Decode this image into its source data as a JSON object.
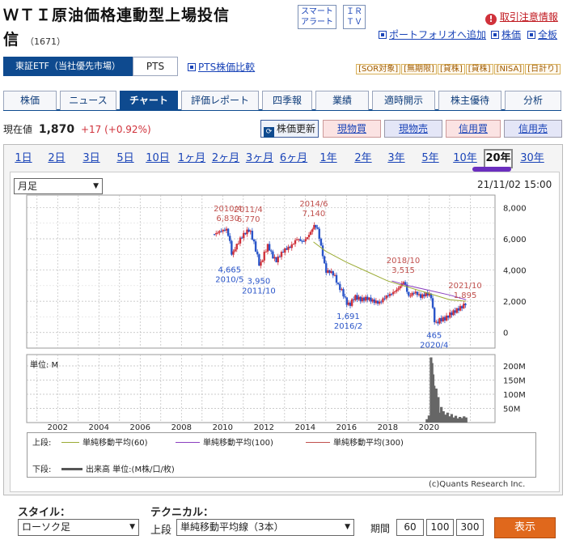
{
  "header": {
    "title": "ＷＴＩ原油価格連動型上場投信",
    "code": "（1671）",
    "smart_alert": [
      "スマート",
      "アラート"
    ],
    "ir_tv": [
      "ＩＲ",
      "ＴＶ"
    ],
    "caution": "取引注意情報",
    "portfolio_add": "ポートフォリオへ追加",
    "stock_price": "株価",
    "full_board": "全板"
  },
  "market": {
    "tab_active": "東証ETF（当社優先市場）",
    "tab_pts": "PTS",
    "pts_compare": "PTS株価比較",
    "badges": [
      "[SOR対象]",
      "[無期限]",
      "[貸株]",
      "[貸株]",
      "[NISA]",
      "[日計り]"
    ]
  },
  "nav": [
    "株価",
    "ニュース",
    "チャート",
    "評価レポート",
    "四季報",
    "業績",
    "適時開示",
    "株主優待",
    "分析"
  ],
  "quote": {
    "label": "現在値",
    "price": "1,870",
    "change": "+17 (+0.92%)",
    "refresh": "株価更新",
    "buttons": [
      "現物買",
      "現物売",
      "信用買",
      "信用売"
    ]
  },
  "periods": [
    "1日",
    "2日",
    "3日",
    "5日",
    "10日",
    "1ヶ月",
    "2ヶ月",
    "3ヶ月",
    "6ヶ月",
    "1年",
    "2年",
    "3年",
    "5年",
    "10年",
    "20年",
    "30年"
  ],
  "chart_controls": {
    "interval": "月足",
    "timestamp": "21/11/02 15:00",
    "unit": "単位: M",
    "credit": "(c)Quants Research Inc."
  },
  "legend": {
    "upper_label": "上段:",
    "lower_label": "下段:",
    "items": [
      "単純移動平均(60)",
      "単純移動平均(100)",
      "単純移動平均(300)"
    ],
    "volume": "出来高 単位:(M株/口/枚)"
  },
  "bottom": {
    "style_label": "スタイル：",
    "style_value": "ローソク足",
    "tech_label": "テクニカル：",
    "upper": "上段",
    "tech_value": "単純移動平均線（3本）",
    "period_label": "期間",
    "periods": [
      "60",
      "100",
      "300"
    ],
    "show": "表示"
  },
  "colors": {
    "navy": "#0e4a8f",
    "rise": "#d0323b",
    "fall": "#2a55c9",
    "ma60": "#9bab35",
    "ma100": "#8a3fbf",
    "ma300": "#c0504d"
  },
  "chart_data": {
    "type": "candlestick",
    "x_ticks": [
      "2002",
      "2004",
      "2006",
      "2008",
      "2010",
      "2012",
      "2014",
      "2016",
      "2018",
      "2020"
    ],
    "price_ticks": [
      "8,000",
      "6,000",
      "4,000",
      "2,000",
      "0"
    ],
    "volume_ticks": [
      "200M",
      "150M",
      "100M",
      "50M"
    ],
    "price_ylim": [
      -1000,
      8800
    ],
    "volume_ylim": [
      0,
      240
    ],
    "annotations": [
      {
        "date": "2010/4",
        "value": 6830,
        "labels": [
          "2010/4",
          "6,830"
        ],
        "kind": "high"
      },
      {
        "date": "2011/4",
        "value": 6770,
        "labels": [
          "2011/4",
          "6,770"
        ],
        "kind": "high"
      },
      {
        "date": "2014/6",
        "value": 7140,
        "labels": [
          "2014/6",
          "7,140"
        ],
        "kind": "high"
      },
      {
        "date": "2010/5",
        "value": 4665,
        "labels": [
          "4,665",
          "2010/5"
        ],
        "kind": "low"
      },
      {
        "date": "2011/10",
        "value": 3950,
        "labels": [
          "3,950",
          "2011/10"
        ],
        "kind": "low"
      },
      {
        "date": "2016/2",
        "value": 1691,
        "labels": [
          "1,691",
          "2016/2"
        ],
        "kind": "low"
      },
      {
        "date": "2018/10",
        "value": 3515,
        "labels": [
          "2018/10",
          "3,515"
        ],
        "kind": "high"
      },
      {
        "date": "2020/4",
        "value": 465,
        "labels": [
          "465",
          "2020/4"
        ],
        "kind": "low"
      },
      {
        "date": "2021/10",
        "value": 1895,
        "labels": [
          "2021/10",
          "1,895"
        ],
        "kind": "high"
      }
    ],
    "series_close": [
      [
        2009.6,
        6300
      ],
      [
        2009.9,
        6500
      ],
      [
        2010.2,
        6600
      ],
      [
        2010.35,
        5800
      ],
      [
        2010.45,
        4900
      ],
      [
        2010.6,
        5400
      ],
      [
        2010.9,
        6100
      ],
      [
        2011.1,
        6400
      ],
      [
        2011.3,
        6600
      ],
      [
        2011.5,
        5800
      ],
      [
        2011.7,
        4800
      ],
      [
        2011.8,
        4200
      ],
      [
        2012.0,
        5000
      ],
      [
        2012.2,
        5600
      ],
      [
        2012.4,
        4900
      ],
      [
        2012.6,
        4600
      ],
      [
        2012.8,
        5000
      ],
      [
        2013.0,
        5300
      ],
      [
        2013.3,
        5500
      ],
      [
        2013.6,
        6000
      ],
      [
        2013.9,
        5800
      ],
      [
        2014.1,
        6100
      ],
      [
        2014.3,
        6500
      ],
      [
        2014.45,
        6900
      ],
      [
        2014.6,
        6600
      ],
      [
        2014.8,
        5300
      ],
      [
        2015.0,
        3900
      ],
      [
        2015.2,
        3900
      ],
      [
        2015.4,
        3700
      ],
      [
        2015.6,
        3000
      ],
      [
        2015.8,
        2600
      ],
      [
        2016.0,
        1900
      ],
      [
        2016.15,
        1750
      ],
      [
        2016.4,
        2300
      ],
      [
        2016.7,
        2100
      ],
      [
        2017.0,
        2200
      ],
      [
        2017.3,
        2000
      ],
      [
        2017.6,
        1900
      ],
      [
        2017.9,
        2300
      ],
      [
        2018.2,
        2500
      ],
      [
        2018.5,
        2800
      ],
      [
        2018.8,
        3300
      ],
      [
        2019.0,
        2300
      ],
      [
        2019.3,
        2600
      ],
      [
        2019.6,
        2300
      ],
      [
        2019.9,
        2500
      ],
      [
        2020.1,
        2300
      ],
      [
        2020.2,
        1300
      ],
      [
        2020.3,
        500
      ],
      [
        2020.5,
        800
      ],
      [
        2020.8,
        900
      ],
      [
        2021.0,
        1150
      ],
      [
        2021.3,
        1400
      ],
      [
        2021.6,
        1650
      ],
      [
        2021.8,
        1880
      ]
    ],
    "ma_series": {
      "ma60": [
        [
          2014.4,
          5800
        ],
        [
          2015,
          5200
        ],
        [
          2016,
          4500
        ],
        [
          2017,
          3900
        ],
        [
          2018,
          3300
        ],
        [
          2019,
          2900
        ],
        [
          2020,
          2500
        ],
        [
          2021,
          2100
        ],
        [
          2021.8,
          2000
        ]
      ],
      "ma100": [
        [
          2018.2,
          3300
        ],
        [
          2019,
          3000
        ],
        [
          2020,
          2700
        ],
        [
          2021,
          2400
        ],
        [
          2021.8,
          2100
        ]
      ]
    },
    "volume": [
      [
        2019.9,
        12
      ],
      [
        2020.0,
        25
      ],
      [
        2020.1,
        230
      ],
      [
        2020.15,
        210
      ],
      [
        2020.2,
        170
      ],
      [
        2020.25,
        130
      ],
      [
        2020.3,
        80
      ],
      [
        2020.35,
        120
      ],
      [
        2020.4,
        60
      ],
      [
        2020.45,
        90
      ],
      [
        2020.5,
        35
      ],
      [
        2020.6,
        55
      ],
      [
        2020.7,
        40
      ],
      [
        2020.8,
        28
      ],
      [
        2020.9,
        35
      ],
      [
        2021.0,
        22
      ],
      [
        2021.1,
        30
      ],
      [
        2021.2,
        18
      ],
      [
        2021.3,
        24
      ],
      [
        2021.4,
        15
      ],
      [
        2021.5,
        20
      ],
      [
        2021.6,
        16
      ],
      [
        2021.7,
        22
      ],
      [
        2021.8,
        18
      ]
    ]
  }
}
